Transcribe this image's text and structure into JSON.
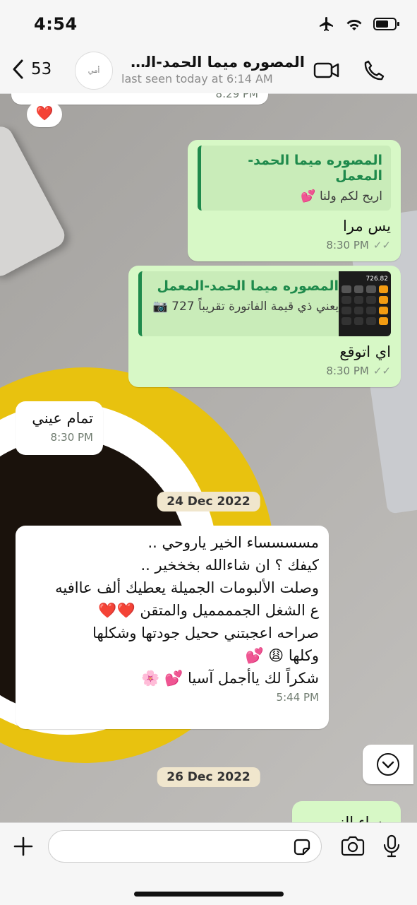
{
  "status": {
    "time": "4:54"
  },
  "header": {
    "back_count": "53",
    "contact_name": "المصوره ميما الحمد-المع...",
    "last_seen": "last seen today at 6:14 AM",
    "avatar_text": "أمي"
  },
  "messages": [
    {
      "id": "top-partial",
      "dir": "in",
      "time": "8:29 PM",
      "reaction": "❤️"
    },
    {
      "id": "m1",
      "dir": "out",
      "quote_name": "المصوره ميما الحمد-المعمل",
      "quote_text": "اريح لكم ولنا 💕",
      "text": "يس مرا",
      "time": "8:30 PM"
    },
    {
      "id": "m2",
      "dir": "out",
      "quote_name": "المصوره ميما الحمد-المعمل",
      "quote_text": "يعني ذي قيمة الفاتورة تقريباً 727",
      "quote_thumb_value": "726.82",
      "text": "اي اتوقع",
      "time": "8:30 PM"
    },
    {
      "id": "m3",
      "dir": "in",
      "text": "تمام عيني",
      "time": "8:30 PM"
    },
    {
      "id": "m4",
      "dir": "in",
      "lines": [
        "مسسسساء الخير ياروحي ..",
        "كيفك ؟ ان شاءالله بخخخير ..",
        "وصلت الألبومات الجميلة يعطيك ألف عاافيه",
        "ع الشغل الجمممميل والمتقن ❤️❤️",
        "صراحه اعجبتني ححيل جودتها وشكلها",
        "وكلها 😩 💕",
        "شكراً لك ياأجمل آسيا 💕 🌸"
      ],
      "time": "5:44 PM"
    },
    {
      "id": "m5",
      "dir": "out",
      "text": "مساء النور"
    }
  ],
  "dates": {
    "d1": "24 Dec 2022",
    "d2": "26 Dec 2022"
  },
  "input": {
    "placeholder": ""
  },
  "colors": {
    "outgoing": "#d7f8c6",
    "incoming": "#ffffff",
    "accent": "#1f8a4c",
    "date_pill": "#f0e6cd"
  }
}
